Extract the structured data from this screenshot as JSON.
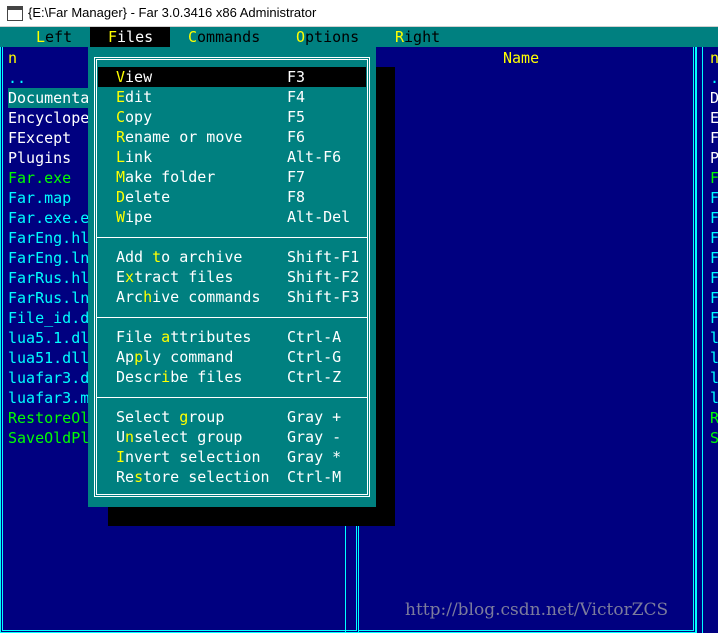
{
  "window": {
    "title": "{E:\\Far Manager} - Far 3.0.3416 x86 Administrator"
  },
  "menubar": {
    "items": [
      {
        "label": "Left",
        "hotkey_index": 0
      },
      {
        "label": "Files",
        "hotkey_index": 0,
        "active": true
      },
      {
        "label": "Commands",
        "hotkey_index": 0
      },
      {
        "label": "Options",
        "hotkey_index": 0
      },
      {
        "label": "Right",
        "hotkey_index": 0
      }
    ]
  },
  "left_panel": {
    "column_header_1": "n",
    "column_header_2": "Name",
    "files": [
      {
        "name": "..",
        "kind": "file"
      },
      {
        "name": "Documenta",
        "kind": "dir",
        "highlight": true
      },
      {
        "name": "Encyclope",
        "kind": "dir"
      },
      {
        "name": "FExcept",
        "kind": "dir"
      },
      {
        "name": "Plugins",
        "kind": "dir"
      },
      {
        "name": "Far.exe",
        "kind": "exe"
      },
      {
        "name": "Far.map",
        "kind": "file"
      },
      {
        "name": "Far.exe.e",
        "kind": "file"
      },
      {
        "name": "FarEng.hl",
        "kind": "file"
      },
      {
        "name": "FarEng.ln",
        "kind": "file"
      },
      {
        "name": "FarRus.hl",
        "kind": "file"
      },
      {
        "name": "FarRus.ln",
        "kind": "file"
      },
      {
        "name": "File_id.d",
        "kind": "file"
      },
      {
        "name": "lua5.1.dl",
        "kind": "file"
      },
      {
        "name": "lua51.dll",
        "kind": "file"
      },
      {
        "name": "luafar3.d",
        "kind": "file"
      },
      {
        "name": "luafar3.m",
        "kind": "file"
      },
      {
        "name": "RestoreOl",
        "kind": "exe"
      },
      {
        "name": "SaveOldPl",
        "kind": "exe"
      }
    ]
  },
  "right_panel": {
    "column_header": "n",
    "files": [
      {
        "name": ".",
        "kind": "file"
      },
      {
        "name": "D",
        "kind": "dir"
      },
      {
        "name": "E",
        "kind": "dir"
      },
      {
        "name": "F",
        "kind": "dir"
      },
      {
        "name": "P",
        "kind": "dir"
      },
      {
        "name": "F",
        "kind": "exe"
      },
      {
        "name": "F",
        "kind": "file"
      },
      {
        "name": "F",
        "kind": "file"
      },
      {
        "name": "F",
        "kind": "file"
      },
      {
        "name": "F",
        "kind": "file"
      },
      {
        "name": "F",
        "kind": "file"
      },
      {
        "name": "F",
        "kind": "file"
      },
      {
        "name": "F",
        "kind": "file"
      },
      {
        "name": "l",
        "kind": "file"
      },
      {
        "name": "l",
        "kind": "file"
      },
      {
        "name": "l",
        "kind": "file"
      },
      {
        "name": "l",
        "kind": "file"
      },
      {
        "name": "R",
        "kind": "exe"
      },
      {
        "name": "S",
        "kind": "exe"
      }
    ]
  },
  "files_menu": {
    "groups": [
      [
        {
          "label": "View",
          "hotkey_index": 0,
          "key": "F3",
          "selected": true
        },
        {
          "label": "Edit",
          "hotkey_index": 0,
          "key": "F4"
        },
        {
          "label": "Copy",
          "hotkey_index": 0,
          "key": "F5"
        },
        {
          "label": "Rename or move",
          "hotkey_index": 0,
          "key": "F6"
        },
        {
          "label": "Link",
          "hotkey_index": 0,
          "key": "Alt-F6"
        },
        {
          "label": "Make folder",
          "hotkey_index": 0,
          "key": "F7"
        },
        {
          "label": "Delete",
          "hotkey_index": 0,
          "key": "F8"
        },
        {
          "label": "Wipe",
          "hotkey_index": 0,
          "key": "Alt-Del"
        }
      ],
      [
        {
          "label": "Add to archive",
          "hotkey_index": 4,
          "key": "Shift-F1"
        },
        {
          "label": "Extract files",
          "hotkey_index": 1,
          "key": "Shift-F2"
        },
        {
          "label": "Archive commands",
          "hotkey_index": 3,
          "key": "Shift-F3"
        }
      ],
      [
        {
          "label": "File attributes",
          "hotkey_index": 5,
          "key": "Ctrl-A"
        },
        {
          "label": "Apply command",
          "hotkey_index": 2,
          "key": "Ctrl-G"
        },
        {
          "label": "Describe files",
          "hotkey_index": 5,
          "key": "Ctrl-Z"
        }
      ],
      [
        {
          "label": "Select group",
          "hotkey_index": 7,
          "key": "Gray +"
        },
        {
          "label": "Unselect group",
          "hotkey_index": 1,
          "key": "Gray -"
        },
        {
          "label": "Invert selection",
          "hotkey_index": 0,
          "key": "Gray *"
        },
        {
          "label": "Restore selection",
          "hotkey_index": 2,
          "key": "Ctrl-M"
        }
      ]
    ]
  },
  "watermark": "http://blog.csdn.net/VictorZCS",
  "colors": {
    "panel_bg": "#000080",
    "menu_bg": "#008080",
    "border": "#00ffff",
    "hotkey": "#ffff00",
    "exe": "#00ff00",
    "dir": "#ffffff",
    "file": "#00ffff"
  }
}
